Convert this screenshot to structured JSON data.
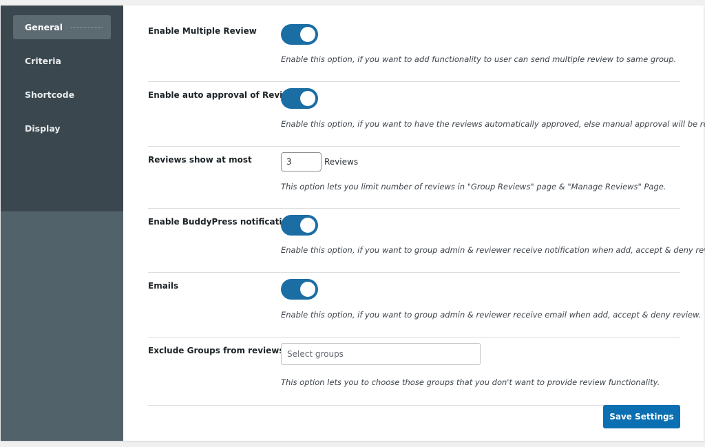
{
  "sidebar": {
    "items": [
      {
        "label": "General"
      },
      {
        "label": "Criteria"
      },
      {
        "label": "Shortcode"
      },
      {
        "label": "Display"
      }
    ]
  },
  "settings": {
    "multiple_review": {
      "label": "Enable Multiple Review",
      "enabled": true,
      "description": "Enable this option, if you want to add functionality to user can send multiple review to same group."
    },
    "auto_approval": {
      "label": "Enable auto approval of Reviews",
      "enabled": true,
      "description": "Enable this option, if you want to have the reviews automatically approved, else manual approval will be required."
    },
    "reviews_at_most": {
      "label": "Reviews show at most",
      "value": "3",
      "unit": "Reviews",
      "description": "This option lets you limit number of reviews in \"Group Reviews\" page & \"Manage Reviews\" Page."
    },
    "buddypress_notifications": {
      "label": "Enable BuddyPress notifications",
      "enabled": true,
      "description": "Enable this option, if you want to group admin & reviewer receive notification when add, accept & deny review."
    },
    "emails": {
      "label": "Emails",
      "enabled": true,
      "description": "Enable this option, if you want to group admin & reviewer receive email when add, accept & deny review."
    },
    "exclude_groups": {
      "label": "Exclude Groups from reviews",
      "placeholder": "Select groups",
      "description": "This option lets you to choose those groups that you don't want to provide review functionality."
    }
  },
  "save_button": {
    "label": "Save Settings"
  },
  "colors": {
    "accent": "#0b6fb2",
    "toggle_on": "#1b6ea4",
    "sidebar_dark": "#3b474e",
    "sidebar_light": "#52626a"
  }
}
